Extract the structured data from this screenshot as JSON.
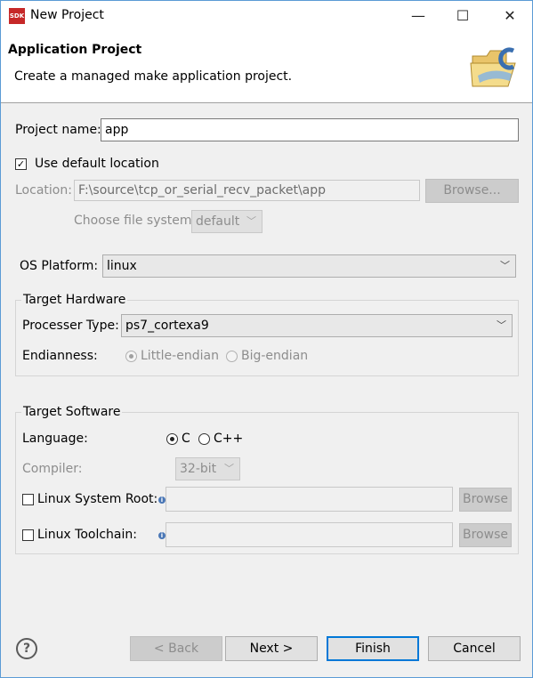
{
  "window": {
    "title": "New Project",
    "app_badge": "SDK",
    "controls": {
      "minimize": "—",
      "maximize": "☐",
      "close": "✕"
    }
  },
  "header": {
    "title": "Application Project",
    "description": "Create a managed make application project."
  },
  "project": {
    "name_label": "Project name:",
    "name_value": "app",
    "use_default_label": "Use default location",
    "use_default_checked": true,
    "location_label": "Location:",
    "location_value": "F:\\source\\tcp_or_serial_recv_packet\\app",
    "browse_label": "Browse...",
    "filesystem_label": "Choose file system:",
    "filesystem_value": "default"
  },
  "os": {
    "label": "OS Platform:",
    "value": "linux"
  },
  "target_hardware": {
    "title": "Target Hardware",
    "processor_label": "Processer Type:",
    "processor_value": "ps7_cortexa9",
    "endianness_label": "Endianness:",
    "little_label": "Little-endian",
    "big_label": "Big-endian",
    "selected": "Little-endian"
  },
  "target_software": {
    "title": "Target Software",
    "language_label": "Language:",
    "lang_c": "C",
    "lang_cpp": "C++",
    "selected_language": "C",
    "compiler_label": "Compiler:",
    "compiler_value": "32-bit",
    "sysroot_label": "Linux System Root:",
    "toolchain_label": "Linux Toolchain:",
    "browse_label": "Browse",
    "info_glyph": "i"
  },
  "footer": {
    "help_glyph": "?",
    "back_label": "< Back",
    "next_label": "Next >",
    "finish_label": "Finish",
    "cancel_label": "Cancel"
  },
  "colors": {
    "accent": "#0078d7",
    "window_border": "#5b9bd5"
  },
  "icons": {
    "app_icon": "sdk-icon",
    "wizard_banner": "folder-c-icon"
  }
}
